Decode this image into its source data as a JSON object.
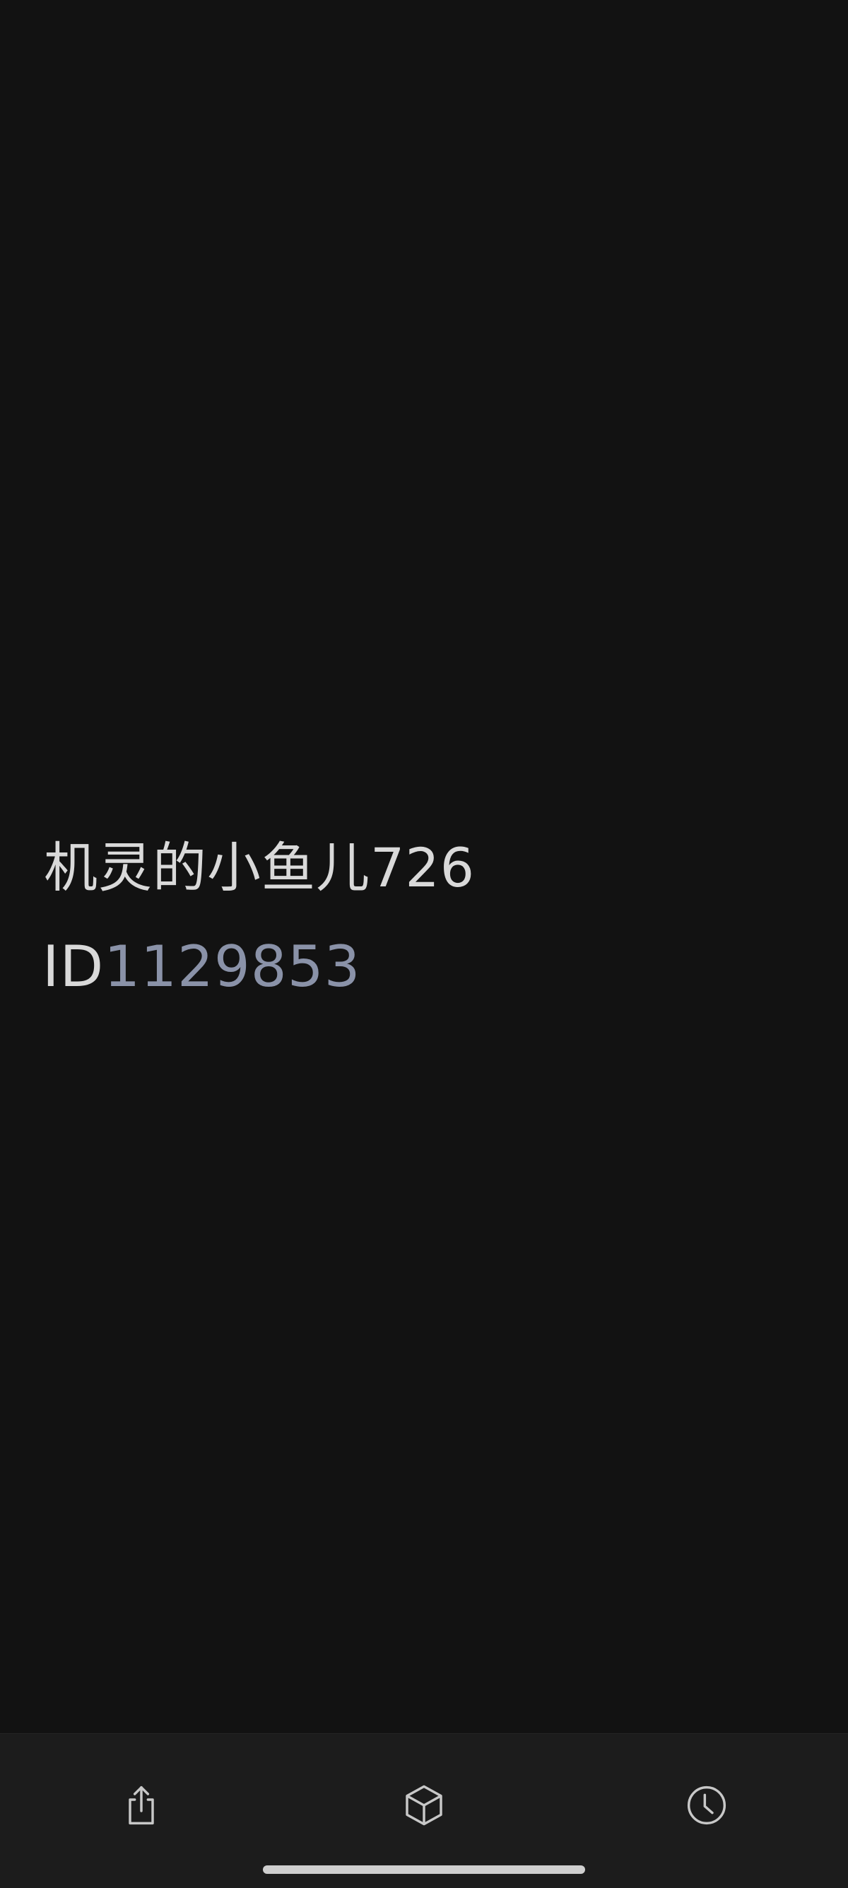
{
  "profile": {
    "username": "机灵的小鱼儿726",
    "id_prefix": "ID",
    "id_number": "1129853"
  },
  "bottom_nav": {
    "items": [
      {
        "icon": "share-icon"
      },
      {
        "icon": "cube-icon"
      },
      {
        "icon": "clock-icon"
      }
    ]
  },
  "colors": {
    "background": "#121212",
    "bottom_bar": "#1c1c1c",
    "text_primary": "#d9d9d9",
    "id_accent": "#8a92a8"
  }
}
